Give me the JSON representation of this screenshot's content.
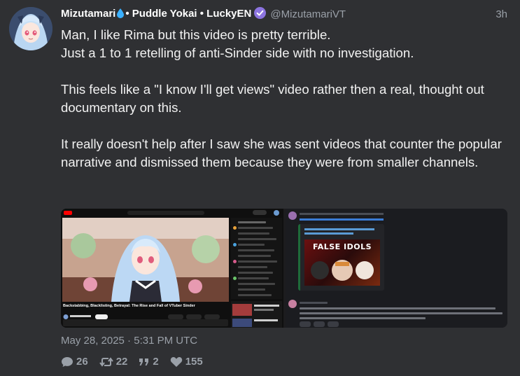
{
  "author": {
    "display_name_prefix": "Mizutamari",
    "display_name_suffix": "• Puddle Yokai • LuckyEN",
    "handle": "@MizutamariVT",
    "avatar_icon": "anime-avatar-icon"
  },
  "time_ago": "3h",
  "post": {
    "paragraphs": [
      "Man, I like Rima but this video is pretty terrible.\nJust a 1 to 1 retelling of anti-Sinder side with no investigation.",
      "This feels like a \"I know I'll get views\" video rather then a real, thought out documentary on this.",
      "It really doesn't help after I saw she was sent videos that counter the popular narrative and dismissed them because they were from smaller channels."
    ]
  },
  "attachments": {
    "left": {
      "type": "screenshot",
      "video_title": "Backstabbing, Blacklisting, Betrayal: The Rise and Fall of VTuber Sinder"
    },
    "right": {
      "type": "screenshot",
      "embed_headline": "FALSE IDOLS"
    }
  },
  "timestamp": "May 28, 2025 · 5:31 PM UTC",
  "stats": {
    "replies": "26",
    "reposts": "22",
    "quotes": "2",
    "likes": "155"
  },
  "colors": {
    "background": "#2f3033",
    "verified": "#8c74e0",
    "muted": "#9aa0a8",
    "drop": "#3ab0ff"
  }
}
